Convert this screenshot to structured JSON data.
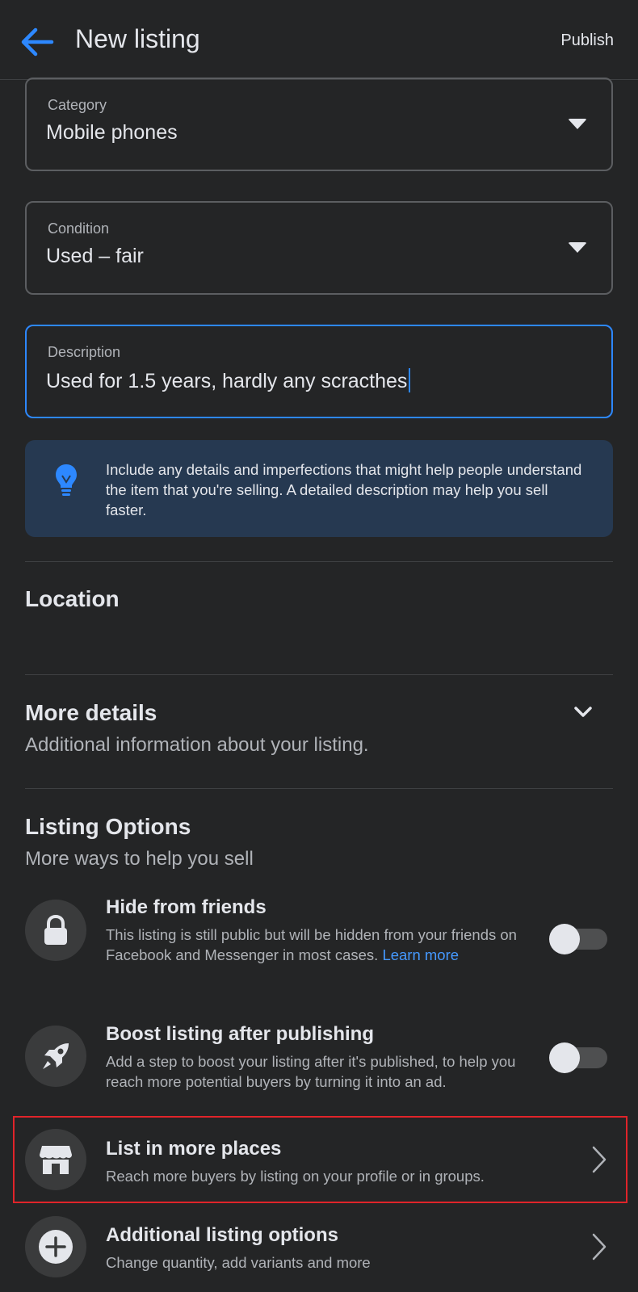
{
  "header": {
    "title": "New listing",
    "publish_label": "Publish"
  },
  "fields": {
    "category": {
      "label": "Category",
      "value": "Mobile phones"
    },
    "condition": {
      "label": "Condition",
      "value": "Used – fair"
    },
    "description": {
      "label": "Description",
      "value": "Used for 1.5 years, hardly any scracthes"
    }
  },
  "tip": {
    "icon": "lightbulb-icon",
    "text": "Include any details and imperfections that might help people understand the item that you're selling. A detailed description may help you sell faster."
  },
  "location": {
    "title": "Location"
  },
  "more_details": {
    "title": "More details",
    "subtitle": "Additional information about your listing."
  },
  "listing_options": {
    "title": "Listing Options",
    "subtitle": "More ways to help you sell",
    "items": [
      {
        "icon": "lock-icon",
        "title": "Hide from friends",
        "desc": "This listing is still public but will be hidden from your friends on Facebook and Messenger in most cases.",
        "link": "Learn more",
        "toggle_on": false
      },
      {
        "icon": "rocket-icon",
        "title": "Boost listing after publishing",
        "desc": "Add a step to boost your listing after it's published, to help you reach more potential buyers by turning it into an ad.",
        "toggle_on": false
      },
      {
        "icon": "store-icon",
        "title": "List in more places",
        "desc": "Reach more buyers by listing on your profile or in groups.",
        "highlighted": true
      },
      {
        "icon": "plus-icon",
        "title": "Additional listing options",
        "desc": "Change quantity, add variants and more"
      }
    ]
  },
  "colors": {
    "background": "#242526",
    "accent": "#2d88ff",
    "tip_background": "#263951",
    "highlight_border": "#e0242a"
  }
}
